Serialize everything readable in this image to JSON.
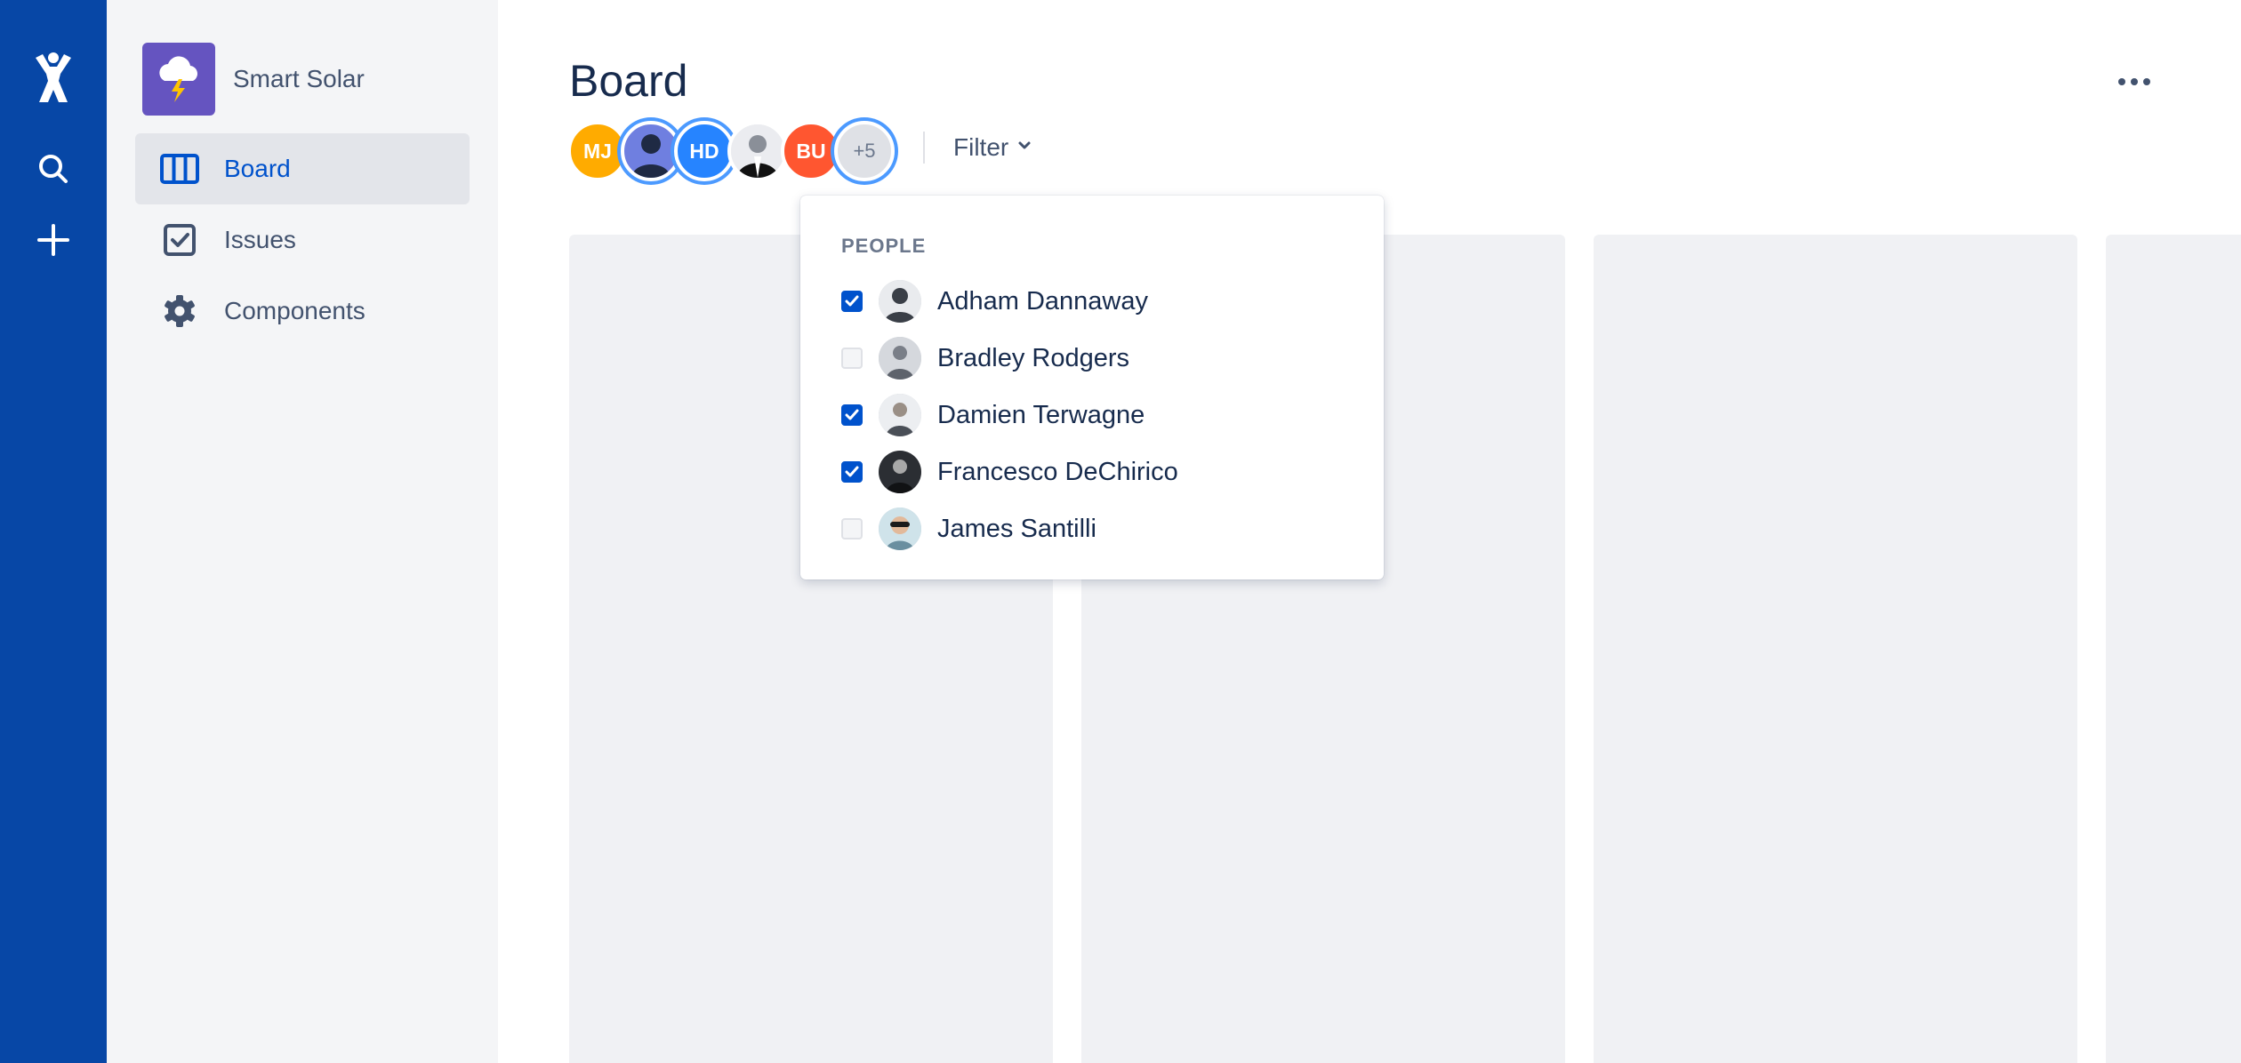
{
  "project": {
    "name": "Smart Solar"
  },
  "nav": {
    "board": "Board",
    "issues": "Issues",
    "components": "Components"
  },
  "page": {
    "title": "Board"
  },
  "avatars": [
    {
      "initials": "MJ",
      "color": "#ffab00"
    },
    {
      "initials": "",
      "color": "#6f7fe0",
      "selected": true
    },
    {
      "initials": "HD",
      "color": "#2684ff",
      "selected": true
    },
    {
      "initials": "",
      "color": "#ebecf0"
    },
    {
      "initials": "BU",
      "color": "#ff5630"
    },
    {
      "initials": "+5",
      "color": "#dfe1e6",
      "selected": true
    }
  ],
  "filter": {
    "label": "Filter"
  },
  "dropdown": {
    "heading": "PEOPLE",
    "people": [
      {
        "name": "Adham Dannaway",
        "checked": true
      },
      {
        "name": "Bradley Rodgers",
        "checked": false
      },
      {
        "name": "Damien Terwagne",
        "checked": true
      },
      {
        "name": "Francesco DeChirico",
        "checked": true
      },
      {
        "name": "James Santilli",
        "checked": false
      }
    ]
  },
  "colors": {
    "global_nav": "#0747a6",
    "sidebar": "#f4f5f7",
    "accent": "#0052cc",
    "column": "#f0f1f4"
  },
  "icons": {
    "logo": "atlassian-logo-icon",
    "search": "search-icon",
    "create": "plus-icon",
    "project": "cloud-lightning-icon",
    "board": "board-columns-icon",
    "issues": "checkbox-icon",
    "components": "gear-icon",
    "more": "more-horizontal-icon",
    "filter_chevron": "chevron-down-icon"
  }
}
